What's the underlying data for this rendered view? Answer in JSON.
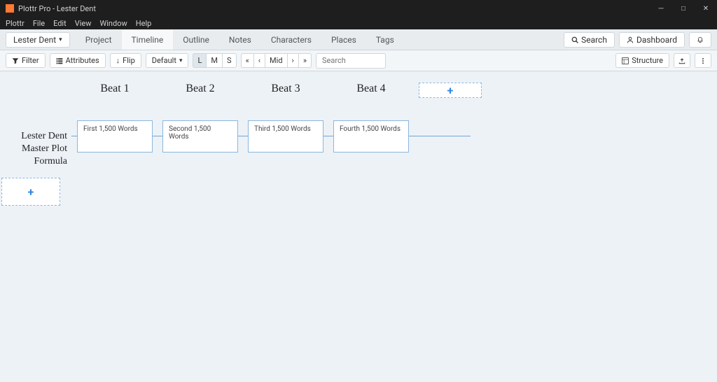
{
  "window": {
    "title": "Plottr Pro - Lester Dent"
  },
  "menu": {
    "items": [
      "Plottr",
      "File",
      "Edit",
      "View",
      "Window",
      "Help"
    ]
  },
  "topnav": {
    "project_dropdown": "Lester Dent",
    "tabs": [
      "Project",
      "Timeline",
      "Outline",
      "Notes",
      "Characters",
      "Places",
      "Tags"
    ],
    "active_tab": "Timeline",
    "search_label": "Search",
    "dashboard_label": "Dashboard"
  },
  "toolbar": {
    "filter": "Filter",
    "attributes": "Attributes",
    "flip": "Flip",
    "default": "Default",
    "zoom": {
      "L": "L",
      "M": "M",
      "S": "S"
    },
    "nav": {
      "first": "«",
      "prev": "‹",
      "mid": "Mid",
      "next": "›",
      "last": "»"
    },
    "search_placeholder": "Search",
    "structure": "Structure"
  },
  "timeline": {
    "beats": [
      "Beat 1",
      "Beat 2",
      "Beat 3",
      "Beat 4"
    ],
    "plotline": "Lester Dent Master Plot Formula",
    "cards": [
      "First 1,500 Words",
      "Second 1,500 Words",
      "Third 1,500 Words",
      "Fourth 1,500 Words"
    ],
    "add": "+"
  }
}
